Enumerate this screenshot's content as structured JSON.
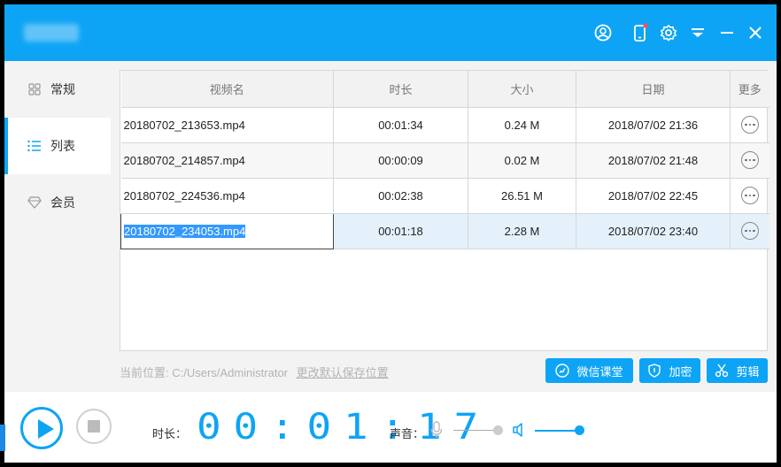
{
  "window": {
    "title": ""
  },
  "colors": {
    "accent": "#0ea4f5",
    "selection": "#3399ff",
    "row_selected_bg": "#e4f1fb"
  },
  "titlebar_icons": [
    "user-icon",
    "phone-icon",
    "settings-icon",
    "dropdown-icon",
    "minimize-icon",
    "close-icon"
  ],
  "sidebar": {
    "items": [
      {
        "label": "常规",
        "icon": "grid-icon"
      },
      {
        "label": "列表",
        "icon": "list-icon"
      },
      {
        "label": "会员",
        "icon": "diamond-icon"
      }
    ],
    "active_index": 1
  },
  "table": {
    "columns": [
      "视频名",
      "时长",
      "大小",
      "日期",
      "更多"
    ],
    "rows": [
      {
        "name": "20180702_213653.mp4",
        "duration": "00:01:34",
        "size": "0.24 M",
        "date": "2018/07/02 21:36"
      },
      {
        "name": "20180702_214857.mp4",
        "duration": "00:00:09",
        "size": "0.02 M",
        "date": "2018/07/02 21:48"
      },
      {
        "name": "20180702_224536.mp4",
        "duration": "00:02:38",
        "size": "26.51 M",
        "date": "2018/07/02 22:45"
      },
      {
        "name": "20180702_234053.mp4",
        "duration": "00:01:18",
        "size": "2.28 M",
        "date": "2018/07/02 23:40"
      }
    ],
    "selected_row": 3
  },
  "footer": {
    "location_label": "当前位置:",
    "location_path": "C:/Users/Administrator",
    "change_link": "更改默认保存位置",
    "buttons": [
      {
        "label": "微信课堂",
        "icon": "wechat-icon"
      },
      {
        "label": "加密",
        "icon": "shield-icon"
      },
      {
        "label": "剪辑",
        "icon": "scissors-icon"
      }
    ]
  },
  "player": {
    "duration_label": "时长：",
    "timer": "00:01:17",
    "volume_label": "声音：",
    "mic_level": 0.85,
    "speaker_level": 1.0
  }
}
